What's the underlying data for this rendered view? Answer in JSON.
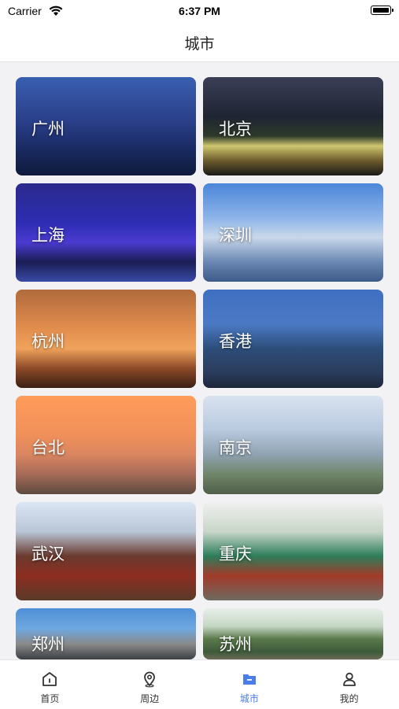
{
  "status": {
    "carrier": "Carrier",
    "time": "6:37 PM"
  },
  "header": {
    "title": "城市"
  },
  "cities": [
    {
      "name": "广州"
    },
    {
      "name": "北京"
    },
    {
      "name": "上海"
    },
    {
      "name": "深圳"
    },
    {
      "name": "杭州"
    },
    {
      "name": "香港"
    },
    {
      "name": "台北"
    },
    {
      "name": "南京"
    },
    {
      "name": "武汉"
    },
    {
      "name": "重庆"
    },
    {
      "name": "郑州"
    },
    {
      "name": "苏州"
    }
  ],
  "tabs": [
    {
      "label": "首页",
      "icon": "home-icon"
    },
    {
      "label": "周边",
      "icon": "location-pin-icon"
    },
    {
      "label": "城市",
      "icon": "folder-icon",
      "active": true
    },
    {
      "label": "我的",
      "icon": "user-icon"
    }
  ],
  "colors": {
    "accent": "#4a7de8"
  }
}
